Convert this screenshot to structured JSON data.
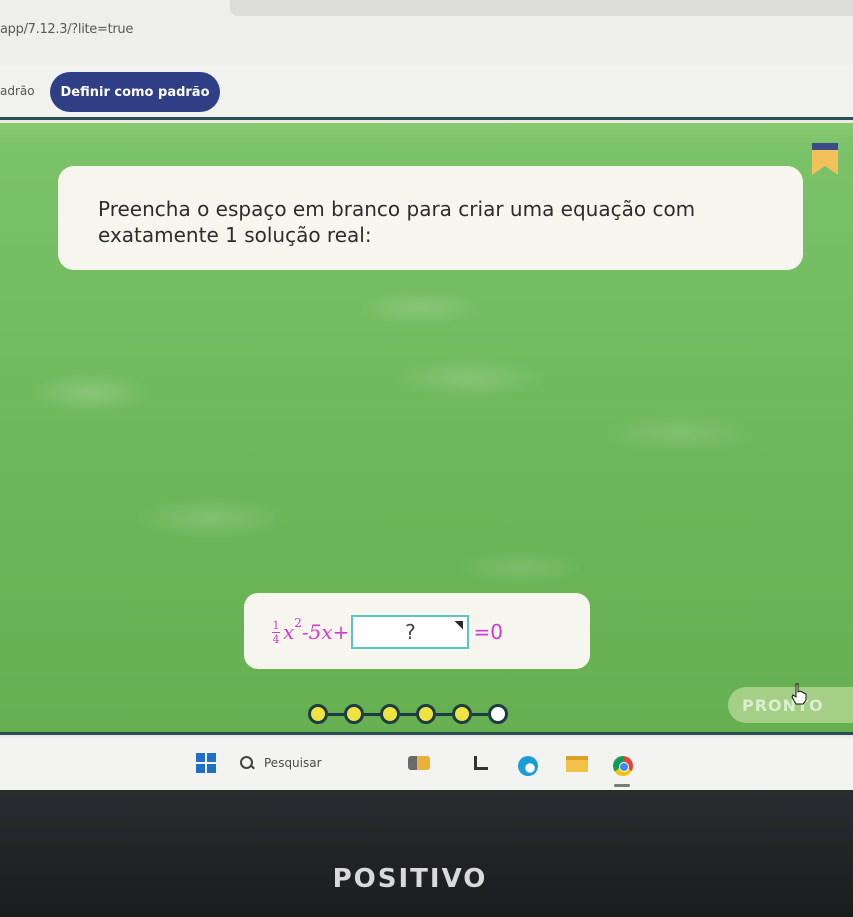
{
  "browser": {
    "url_fragment": "app/7.12.3/?lite=true"
  },
  "infobar": {
    "text_fragment": "adrão",
    "default_button_label": "Definir como padrão"
  },
  "game": {
    "question": "Preencha o espaço em branco para criar uma equação com exatamente 1 solução real:",
    "equation": {
      "fraction_numerator": "1",
      "fraction_denominator": "4",
      "variable": "x",
      "exponent": "2",
      "middle": "-5x+",
      "placeholder": "?",
      "rhs": "=0"
    },
    "progress": {
      "filled": 5,
      "total": 6
    },
    "ready_button_label": "PRONTO"
  },
  "taskbar": {
    "search_label": "Pesquisar"
  },
  "device": {
    "brand": "POSITIVO"
  },
  "colors": {
    "equation_text": "#d23ad0",
    "game_background": "#6db75a",
    "dot_filled": "#f0e442",
    "primary_button": "#2f3f86"
  }
}
